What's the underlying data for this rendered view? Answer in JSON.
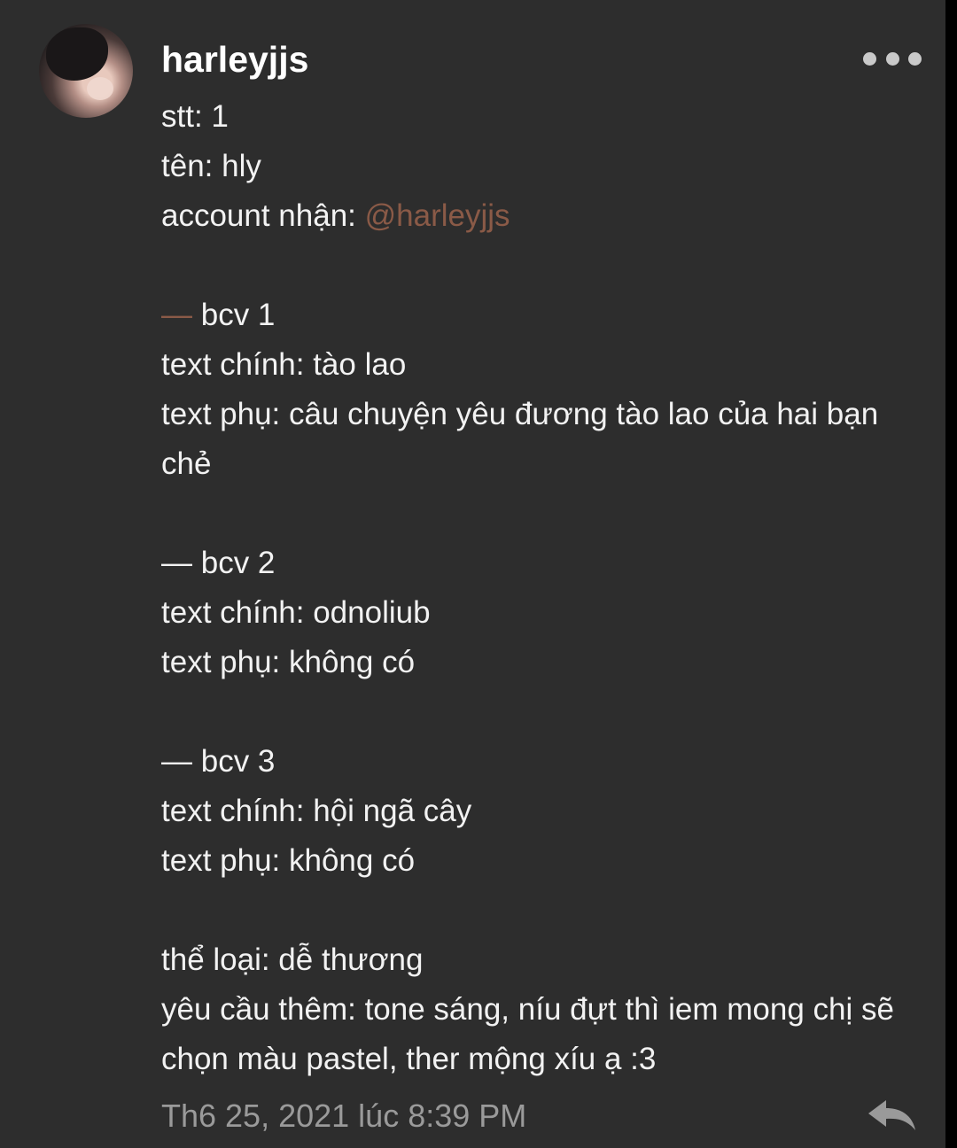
{
  "post": {
    "username": "harleyjjs",
    "timestamp": "Th6 25, 2021 lúc 8:39 PM",
    "lines": {
      "stt": "stt: 1",
      "ten": "tên: hly",
      "account_label": "account nhận: ",
      "account_mention": "@harleyjjs",
      "bcv1_dash": "—",
      "bcv1_title": " bcv 1",
      "bcv1_main": "text chính: tào lao",
      "bcv1_sub_1": "text phụ: câu chuyện yêu đương tào lao của hai bạn",
      "bcv1_sub_2": "chẻ",
      "bcv2_title": "— bcv 2",
      "bcv2_main": "text chính: odnoliub",
      "bcv2_sub": "text phụ: không có",
      "bcv3_title": "— bcv 3",
      "bcv3_main": "text chính: hội ngã cây",
      "bcv3_sub": "text phụ: không có",
      "the_loai": "thể loại: dễ thương",
      "yeu_cau_1": "yêu cầu thêm: tone sáng, níu đựt thì iem mong chị sẽ",
      "yeu_cau_2": "chọn màu pastel, ther mộng xíu ạ :3"
    }
  },
  "icons": {
    "more": "more-horizontal-icon",
    "reply": "reply-arrow-icon",
    "avatar": "user-avatar"
  },
  "colors": {
    "background": "#2d2d2d",
    "text": "#f2f2f2",
    "mention": "#8a5a47",
    "timestamp": "#9a9a9a"
  }
}
